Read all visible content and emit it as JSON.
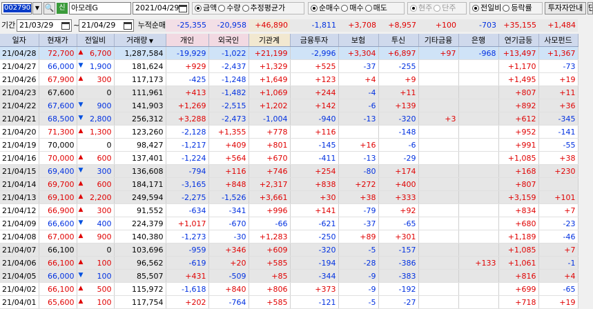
{
  "toolbar": {
    "code": "002790",
    "sin_badge": "신",
    "stock_name": "아모레G",
    "date": "2021/04/29",
    "unit_radios": [
      {
        "label": "금액",
        "on": true
      },
      {
        "label": "수량",
        "on": false
      },
      {
        "label": "추정평균가",
        "on": false
      }
    ],
    "trade_radios": [
      {
        "label": "순매수",
        "on": true
      },
      {
        "label": "매수",
        "on": false
      },
      {
        "label": "매도",
        "on": false
      }
    ],
    "price_radios": [
      {
        "label": "현주",
        "on": true
      },
      {
        "label": "단주",
        "on": false
      }
    ],
    "cmp_radios": [
      {
        "label": "전일비",
        "on": true
      },
      {
        "label": "등락률",
        "on": false
      }
    ],
    "guide_btn": "투자자안내",
    "extra_btn": "단"
  },
  "period": {
    "label": "기간",
    "from": "21/03/29",
    "to": "21/04/29",
    "tilde": "~",
    "cum_label": "누적순매수",
    "sums": [
      "-25,355",
      "-20,958",
      "+46,890",
      "-1,811",
      "+3,708",
      "+8,957",
      "+100",
      "-703",
      "+35,155",
      "+1,484"
    ]
  },
  "columns": [
    "일자",
    "현재가",
    "전일비",
    "거래량",
    "개인",
    "외국인",
    "기관계",
    "금융투자",
    "보험",
    "투신",
    "기타금융",
    "은행",
    "연기금등",
    "사모펀드"
  ],
  "rows": [
    {
      "d": "21/04/28",
      "p": "72,700",
      "dir": "up",
      "c": "6,700",
      "v": "1,287,584",
      "v1": "-19,929",
      "v2": "-1,022",
      "v3": "+21,199",
      "v4": "-2,996",
      "v5": "+3,304",
      "v6": "+6,897",
      "v7": "+97",
      "v8": "-968",
      "v9": "+13,497",
      "v10": "+1,367"
    },
    {
      "d": "21/04/27",
      "p": "66,000",
      "dir": "dn",
      "c": "1,900",
      "v": "181,624",
      "v1": "+929",
      "v2": "-2,437",
      "v3": "+1,329",
      "v4": "+525",
      "v5": "-37",
      "v6": "-255",
      "v7": "",
      "v8": "",
      "v9": "+1,170",
      "v10": "-73"
    },
    {
      "d": "21/04/26",
      "p": "67,900",
      "dir": "up",
      "c": "300",
      "v": "117,173",
      "v1": "-425",
      "v2": "-1,248",
      "v3": "+1,649",
      "v4": "+123",
      "v5": "+4",
      "v6": "+9",
      "v7": "",
      "v8": "",
      "v9": "+1,495",
      "v10": "+19"
    },
    {
      "d": "21/04/23",
      "p": "67,600",
      "dir": "",
      "c": "0",
      "v": "111,961",
      "v1": "+413",
      "v2": "-1,482",
      "v3": "+1,069",
      "v4": "+244",
      "v5": "-4",
      "v6": "+11",
      "v7": "",
      "v8": "",
      "v9": "+807",
      "v10": "+11"
    },
    {
      "d": "21/04/22",
      "p": "67,600",
      "dir": "dn",
      "c": "900",
      "v": "141,903",
      "v1": "+1,269",
      "v2": "-2,515",
      "v3": "+1,202",
      "v4": "+142",
      "v5": "-6",
      "v6": "+139",
      "v7": "",
      "v8": "",
      "v9": "+892",
      "v10": "+36"
    },
    {
      "d": "21/04/21",
      "p": "68,500",
      "dir": "dn",
      "c": "2,800",
      "v": "256,312",
      "v1": "+3,288",
      "v2": "-2,473",
      "v3": "-1,004",
      "v4": "-940",
      "v5": "-13",
      "v6": "-320",
      "v7": "+3",
      "v8": "",
      "v9": "+612",
      "v10": "-345"
    },
    {
      "d": "21/04/20",
      "p": "71,300",
      "dir": "up",
      "c": "1,300",
      "v": "123,260",
      "v1": "-2,128",
      "v2": "+1,355",
      "v3": "+778",
      "v4": "+116",
      "v5": "",
      "v6": "-148",
      "v7": "",
      "v8": "",
      "v9": "+952",
      "v10": "-141"
    },
    {
      "d": "21/04/19",
      "p": "70,000",
      "dir": "",
      "c": "0",
      "v": "98,427",
      "v1": "-1,217",
      "v2": "+409",
      "v3": "+801",
      "v4": "-145",
      "v5": "+16",
      "v6": "-6",
      "v7": "",
      "v8": "",
      "v9": "+991",
      "v10": "-55"
    },
    {
      "d": "21/04/16",
      "p": "70,000",
      "dir": "up",
      "c": "600",
      "v": "137,401",
      "v1": "-1,224",
      "v2": "+564",
      "v3": "+670",
      "v4": "-411",
      "v5": "-13",
      "v6": "-29",
      "v7": "",
      "v8": "",
      "v9": "+1,085",
      "v10": "+38"
    },
    {
      "d": "21/04/15",
      "p": "69,400",
      "dir": "dn",
      "c": "300",
      "v": "136,608",
      "v1": "-794",
      "v2": "+116",
      "v3": "+746",
      "v4": "+254",
      "v5": "-80",
      "v6": "+174",
      "v7": "",
      "v8": "",
      "v9": "+168",
      "v10": "+230"
    },
    {
      "d": "21/04/14",
      "p": "69,700",
      "dir": "up",
      "c": "600",
      "v": "184,171",
      "v1": "-3,165",
      "v2": "+848",
      "v3": "+2,317",
      "v4": "+838",
      "v5": "+272",
      "v6": "+400",
      "v7": "",
      "v8": "",
      "v9": "+807",
      "v10": ""
    },
    {
      "d": "21/04/13",
      "p": "69,100",
      "dir": "up",
      "c": "2,200",
      "v": "249,594",
      "v1": "-2,275",
      "v2": "-1,526",
      "v3": "+3,661",
      "v4": "+30",
      "v5": "+38",
      "v6": "+333",
      "v7": "",
      "v8": "",
      "v9": "+3,159",
      "v10": "+101"
    },
    {
      "d": "21/04/12",
      "p": "66,900",
      "dir": "up",
      "c": "300",
      "v": "91,552",
      "v1": "-634",
      "v2": "-341",
      "v3": "+996",
      "v4": "+141",
      "v5": "-79",
      "v6": "+92",
      "v7": "",
      "v8": "",
      "v9": "+834",
      "v10": "+7"
    },
    {
      "d": "21/04/09",
      "p": "66,600",
      "dir": "dn",
      "c": "400",
      "v": "224,379",
      "v1": "+1,017",
      "v2": "-670",
      "v3": "-66",
      "v4": "-621",
      "v5": "-37",
      "v6": "-65",
      "v7": "",
      "v8": "",
      "v9": "+680",
      "v10": "-23"
    },
    {
      "d": "21/04/08",
      "p": "67,000",
      "dir": "up",
      "c": "900",
      "v": "140,380",
      "v1": "-1,273",
      "v2": "-30",
      "v3": "+1,283",
      "v4": "-250",
      "v5": "+89",
      "v6": "+301",
      "v7": "",
      "v8": "",
      "v9": "+1,189",
      "v10": "-46"
    },
    {
      "d": "21/04/07",
      "p": "66,100",
      "dir": "",
      "c": "0",
      "v": "103,696",
      "v1": "-959",
      "v2": "+346",
      "v3": "+609",
      "v4": "-320",
      "v5": "-5",
      "v6": "-157",
      "v7": "",
      "v8": "",
      "v9": "+1,085",
      "v10": "+7"
    },
    {
      "d": "21/04/06",
      "p": "66,100",
      "dir": "up",
      "c": "100",
      "v": "96,562",
      "v1": "-619",
      "v2": "+20",
      "v3": "+585",
      "v4": "-194",
      "v5": "-28",
      "v6": "-386",
      "v7": "",
      "v8": "+133",
      "v9": "+1,061",
      "v10": "-1"
    },
    {
      "d": "21/04/05",
      "p": "66,000",
      "dir": "dn",
      "c": "100",
      "v": "85,507",
      "v1": "+431",
      "v2": "-509",
      "v3": "+85",
      "v4": "-344",
      "v5": "-9",
      "v6": "-383",
      "v7": "",
      "v8": "",
      "v9": "+816",
      "v10": "+4"
    },
    {
      "d": "21/04/02",
      "p": "66,100",
      "dir": "up",
      "c": "500",
      "v": "115,972",
      "v1": "-1,618",
      "v2": "+840",
      "v3": "+806",
      "v4": "+373",
      "v5": "-9",
      "v6": "-192",
      "v7": "",
      "v8": "",
      "v9": "+699",
      "v10": "-65"
    },
    {
      "d": "21/04/01",
      "p": "65,600",
      "dir": "up",
      "c": "100",
      "v": "117,754",
      "v1": "+202",
      "v2": "-764",
      "v3": "+585",
      "v4": "-121",
      "v5": "-5",
      "v6": "-27",
      "v7": "",
      "v8": "",
      "v9": "+718",
      "v10": "+19"
    }
  ],
  "colors": {
    "up": "#e00000",
    "down": "#0030e0",
    "header": "#cfd9ec",
    "selected": "#cfe3f7",
    "stripe": "#e6e6e6"
  }
}
